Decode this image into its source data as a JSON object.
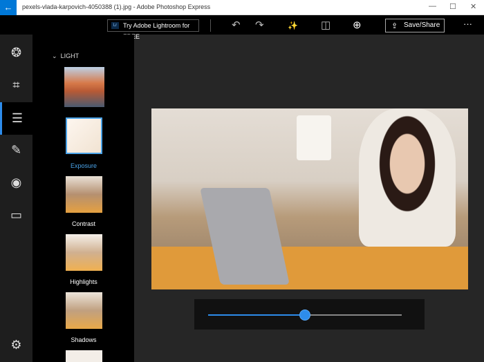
{
  "window": {
    "title": "pexels-vlada-karpovich-4050388 (1).jpg - Adobe Photoshop Express",
    "back": "←",
    "minimize": "—",
    "maximize": "☐",
    "close": "✕"
  },
  "toolbar": {
    "lightroom_badge": "Lr",
    "lightroom_label": "Try Adobe Lightroom for FREE",
    "undo": "↶",
    "redo": "↷",
    "auto": "✨",
    "compare": "◫",
    "zoom": "⊕",
    "save_icon": "⇪",
    "save_label": "Save/Share",
    "more": "···"
  },
  "rail": {
    "looks": "❂",
    "crop": "⌗",
    "adjust": "☰",
    "heal": "✎",
    "eye": "◉",
    "borders": "▭",
    "settings": "⚙"
  },
  "panel": {
    "section_chevron": "⌄",
    "section": "LIGHT",
    "items": [
      {
        "label": "Exposure"
      },
      {
        "label": "Contrast"
      },
      {
        "label": "Highlights"
      },
      {
        "label": "Shadows"
      }
    ]
  },
  "slider": {
    "value": 0.5,
    "accent": "#2d8ceb"
  }
}
